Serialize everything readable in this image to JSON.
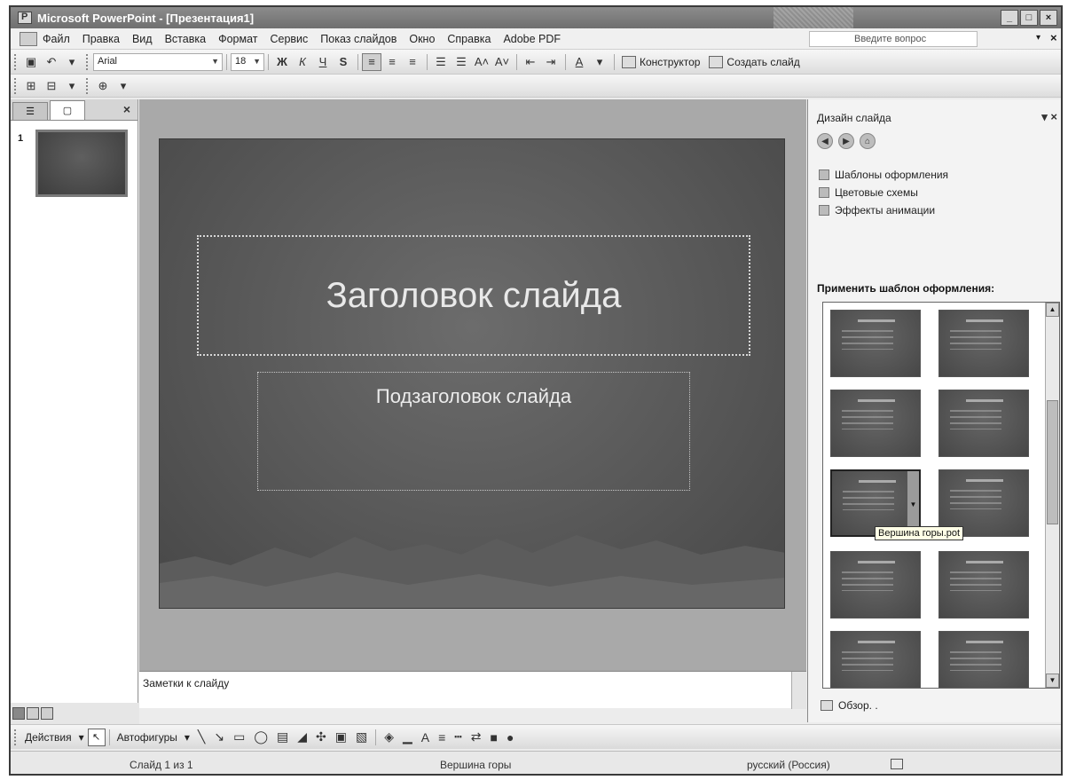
{
  "window": {
    "title": "Microsoft PowerPoint - [Презентация1]",
    "controls": [
      "_",
      "□",
      "×"
    ]
  },
  "menu": {
    "items": [
      "Файл",
      "Правка",
      "Вид",
      "Вставка",
      "Формат",
      "Сервис",
      "Показ слайдов",
      "Окно",
      "Справка",
      "Adobe PDF"
    ],
    "help_placeholder": "Введите вопрос",
    "help_arrow": "▾",
    "close": "×"
  },
  "formatting": {
    "font": "Arial",
    "size": "18",
    "bold": "Ж",
    "italic": "К",
    "underline": "Ч",
    "shadow": "S",
    "font_color": "A",
    "grow_font": "A˄",
    "shrink_font": "A˅",
    "designer": "Конструктор",
    "new_slide": "Создать слайд"
  },
  "left_pane": {
    "close": "×",
    "slide_number": "1"
  },
  "slide": {
    "title": "Заголовок слайда",
    "subtitle": "Подзаголовок слайда"
  },
  "notes": {
    "placeholder": "Заметки к слайду"
  },
  "task_pane": {
    "title": "Дизайн слайда",
    "header_controls": "▾ ×",
    "links": [
      "Шаблоны оформления",
      "Цветовые схемы",
      "Эффекты анимации"
    ],
    "section_label": "Применить шаблон оформления:",
    "tooltip": "Вершина горы.pot",
    "browse": "Обзор. ."
  },
  "drawing": {
    "actions": "Действия",
    "autoshapes": "Автофигуры"
  },
  "status": {
    "slide": "Слайд 1 из 1",
    "design": "Вершина горы",
    "language": "русский (Россия)"
  },
  "colors": {
    "slide_background": "#565656",
    "title_text": "#e9e9e9",
    "tooltip_bg": "#ffffe6"
  }
}
